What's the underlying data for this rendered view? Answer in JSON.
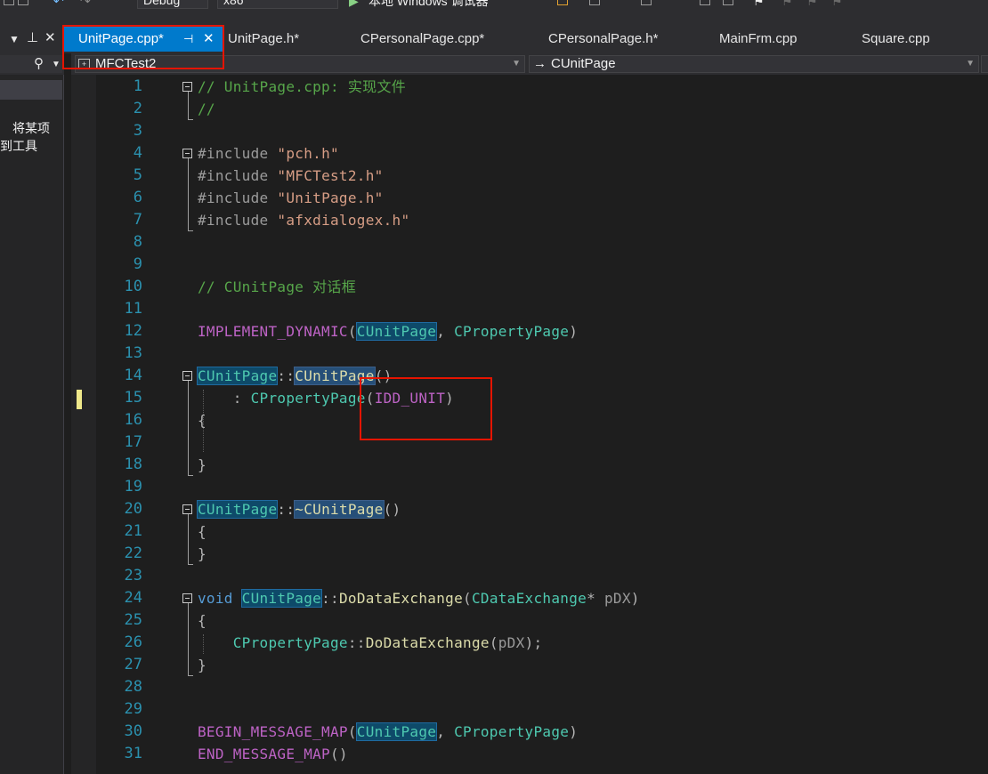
{
  "toolbar": {
    "config": "Debug",
    "platform": "x86",
    "run_target": "本地 Windows 调试器"
  },
  "left_panel": {
    "hint_line1": "将某项",
    "hint_line2": "到工具"
  },
  "tabs": [
    {
      "label": "UnitPage.cpp*",
      "active": true
    },
    {
      "label": "UnitPage.h*",
      "active": false
    },
    {
      "label": "CPersonalPage.cpp*",
      "active": false
    },
    {
      "label": "CPersonalPage.h*",
      "active": false
    },
    {
      "label": "MainFrm.cpp",
      "active": false
    },
    {
      "label": "Square.cpp",
      "active": false
    }
  ],
  "nav": {
    "project": "MFCTest2",
    "scope_arrow": "→",
    "scope": "CUnitPage"
  },
  "code": {
    "l1": "// UnitPage.cpp: 实现文件",
    "l2": "//",
    "l4_dir": "#include",
    "l4_str": "\"pch.h\"",
    "l5_dir": "#include",
    "l5_str": "\"MFCTest2.h\"",
    "l6_dir": "#include",
    "l6_str": "\"UnitPage.h\"",
    "l7_dir": "#include",
    "l7_str": "\"afxdialogex.h\"",
    "l10": "// CUnitPage 对话框",
    "l12_mac": "IMPLEMENT_DYNAMIC",
    "l12_a": "CUnitPage",
    "l12_b": "CPropertyPage",
    "l14_a": "CUnitPage",
    "l14_b": "CUnitPage",
    "l15_base": "CPropertyPage",
    "l15_arg": "IDD_UNIT",
    "l20_a": "CUnitPage",
    "l20_b": "~CUnitPage",
    "l24_kw": "void",
    "l24_cls": "CUnitPage",
    "l24_fn": "DoDataExchange",
    "l24_ty": "CDataExchange",
    "l24_p": "pDX",
    "l26_cls": "CPropertyPage",
    "l26_fn": "DoDataExchange",
    "l26_p": "pDX",
    "l30_mac": "BEGIN_MESSAGE_MAP",
    "l30_a": "CUnitPage",
    "l30_b": "CPropertyPage",
    "l31_mac": "END_MESSAGE_MAP"
  },
  "line_numbers": [
    "1",
    "2",
    "3",
    "4",
    "5",
    "6",
    "7",
    "8",
    "9",
    "10",
    "11",
    "12",
    "13",
    "14",
    "15",
    "16",
    "17",
    "18",
    "19",
    "20",
    "21",
    "22",
    "23",
    "24",
    "25",
    "26",
    "27",
    "28",
    "29",
    "30",
    "31"
  ],
  "colors": {
    "accent": "#007acc",
    "annotation_box": "#e51400",
    "line_number": "#2b91af",
    "comment": "#57a64a",
    "string": "#d69d85",
    "type": "#4ec9b0",
    "keyword": "#569cd6",
    "macro": "#bd63c5",
    "function": "#dcdcaa"
  }
}
